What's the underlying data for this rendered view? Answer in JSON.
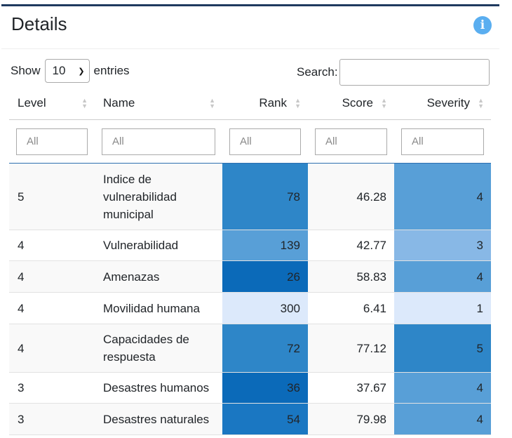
{
  "card": {
    "title": "Details",
    "info_icon": "info-circle-icon"
  },
  "controls": {
    "show_label": "Show",
    "entries_value": "10",
    "entries_label": "entries",
    "search_label": "Search:",
    "search_value": ""
  },
  "table": {
    "headers": {
      "level": "Level",
      "name": "Name",
      "rank": "Rank",
      "score": "Score",
      "severity": "Severity"
    },
    "filter_placeholder": "All",
    "rows": [
      {
        "level": "5",
        "name": "Indice de vulnerabilidad municipal",
        "rank": "78",
        "score": "46.28",
        "severity": "4",
        "rank_color": "#2e86c8",
        "severity_color": "#589fd7"
      },
      {
        "level": "4",
        "name": "Vulnerabilidad",
        "rank": "139",
        "score": "42.77",
        "severity": "3",
        "rank_color": "#589fd7",
        "severity_color": "#88b8e6"
      },
      {
        "level": "4",
        "name": "Amenazas",
        "rank": "26",
        "score": "58.83",
        "severity": "4",
        "rank_color": "#0b6ab9",
        "severity_color": "#589fd7"
      },
      {
        "level": "4",
        "name": "Movilidad humana",
        "rank": "300",
        "score": "6.41",
        "severity": "1",
        "rank_color": "#dce9fb",
        "severity_color": "#dce9fb"
      },
      {
        "level": "4",
        "name": "Capacidades de respuesta",
        "rank": "72",
        "score": "77.12",
        "severity": "5",
        "rank_color": "#2e86c8",
        "severity_color": "#2e86c8"
      },
      {
        "level": "3",
        "name": "Desastres humanos",
        "rank": "36",
        "score": "37.67",
        "severity": "4",
        "rank_color": "#0b6ab9",
        "severity_color": "#589fd7"
      },
      {
        "level": "3",
        "name": "Desastres naturales",
        "rank": "54",
        "score": "79.98",
        "severity": "4",
        "rank_color": "#1a77c2",
        "severity_color": "#589fd7"
      }
    ]
  }
}
